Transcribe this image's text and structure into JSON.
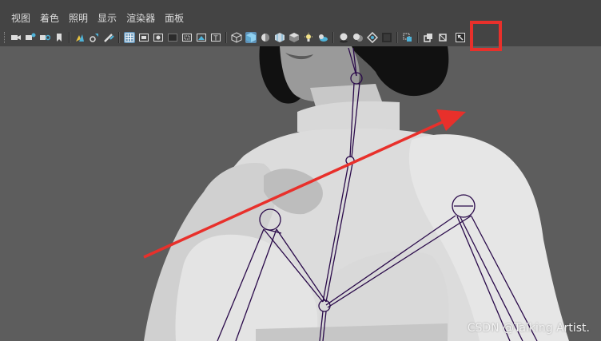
{
  "menubar": {
    "items": [
      "视图",
      "着色",
      "照明",
      "显示",
      "渲染器",
      "面板"
    ]
  },
  "toolbar": {
    "icons": [
      "camera-icon",
      "camera-attributes-icon",
      "bookmark-icon",
      "image-plane-icon",
      "2d-pan-zoom-icon",
      "grease-pencil-icon",
      "grid-icon",
      "film-gate-icon",
      "resolution-gate-icon",
      "gate-mask-icon",
      "field-chart-icon",
      "safe-action-icon",
      "safe-title-icon",
      "wireframe-icon",
      "smooth-shade-icon",
      "default-material-icon",
      "textured-icon",
      "use-all-lights-icon",
      "shadows-icon",
      "ambient-occlusion-icon",
      "motion-blur-icon",
      "anti-aliasing-icon",
      "depth-of-field-icon",
      "isolate-select-icon",
      "xray-icon",
      "xray-joints-icon",
      "xray-active-components-icon"
    ]
  },
  "annotation": {
    "highlighted_button": "xray-joints-icon",
    "arrow_color": "#e8302b"
  },
  "watermark": "CSDN @Talking Artist."
}
